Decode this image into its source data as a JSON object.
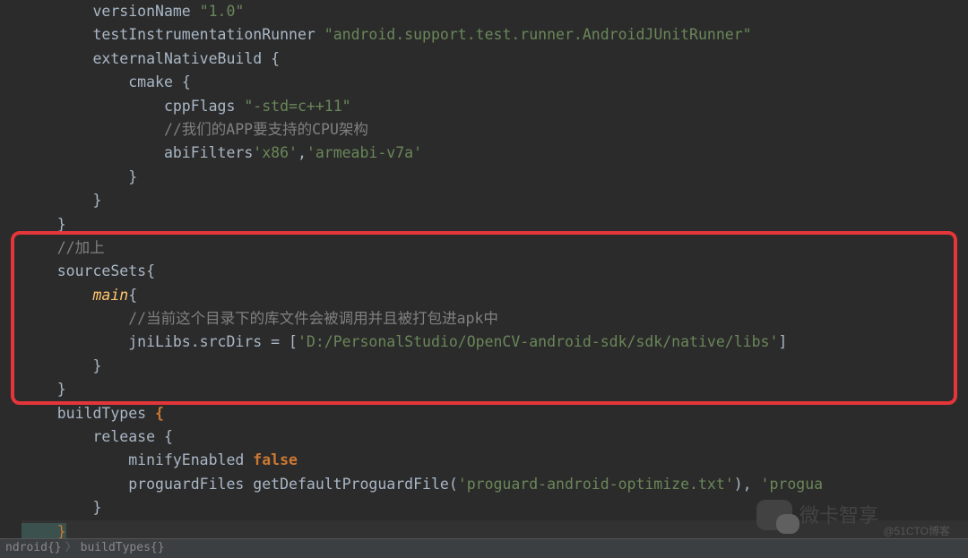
{
  "code": {
    "l1a": "        versionName ",
    "l1b": "\"1.0\"",
    "l2a": "        testInstrumentationRunner ",
    "l2b": "\"android.support.test.runner.AndroidJUnitRunner\"",
    "l3a": "        externalNativeBuild ",
    "l3b": "{",
    "l4a": "            cmake ",
    "l4b": "{",
    "l5a": "                cppFlags ",
    "l5b": "\"-std=c++11\"",
    "l6": "                //我们的APP要支持的CPU架构",
    "l7a": "                abiFilters",
    "l7b": "'x86'",
    "l7c": ",",
    "l7d": "'armeabi-v7a'",
    "l8": "            }",
    "l9": "        }",
    "l10": "    }",
    "l11": "    //加上",
    "l12a": "    sourceSets",
    "l12b": "{",
    "l13a": "        main",
    "l13b": "{",
    "l14": "            //当前这个目录下的库文件会被调用并且被打包进apk中",
    "l15a": "            jniLibs.srcDirs = [",
    "l15b": "'D:/PersonalStudio/OpenCV-android-sdk/sdk/native/libs'",
    "l15c": "]",
    "l16": "        }",
    "l17": "    }",
    "l18a": "    buildTypes ",
    "l18b": "{",
    "l19a": "        release ",
    "l19b": "{",
    "l20a": "            minifyEnabled ",
    "l20b": "false",
    "l21a": "            proguardFiles getDefaultProguardFile(",
    "l21b": "'proguard-android-optimize.txt'",
    "l21c": "), ",
    "l21d": "'progua",
    "l22": "        }",
    "l23": "    }"
  },
  "breadcrumb": {
    "a": "ndroid{}",
    "b": "buildTypes{}"
  },
  "watermark": {
    "name": "微卡智享",
    "sub": "@51CTO博客"
  }
}
